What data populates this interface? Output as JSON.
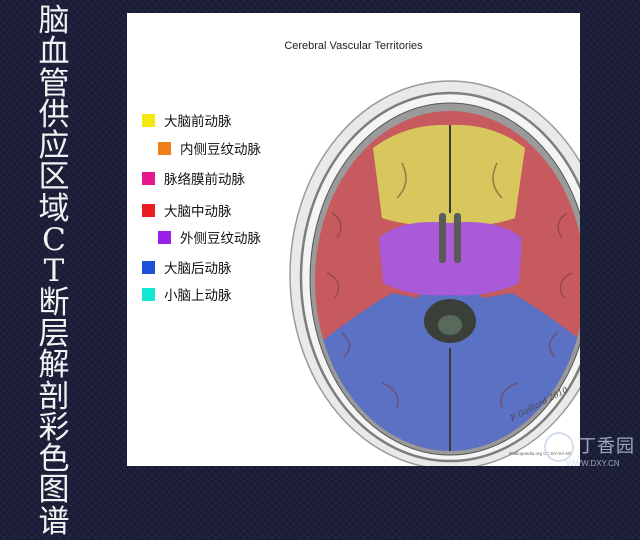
{
  "slide_title": "脑血管供应区域CT断层解剖彩色图谱",
  "figure": {
    "title": "Cerebral Vascular Territories",
    "signature": "F Gaillard 2010",
    "signature_url": "Radiopaedia.org CC BY-SA-NC"
  },
  "legend": [
    {
      "label": "大脑前动脉",
      "color": "#f4e80e"
    },
    {
      "label": "内侧豆纹动脉",
      "color": "#f07f1a"
    },
    {
      "label": "脉络膜前动脉",
      "color": "#e4178c"
    },
    {
      "label": "大脑中动脉",
      "color": "#ec1c24"
    },
    {
      "label": "外侧豆纹动脉",
      "color": "#9b1fe8"
    },
    {
      "label": "大脑后动脉",
      "color": "#1f4fd8"
    },
    {
      "label": "小脑上动脉",
      "color": "#14e6d4"
    }
  ],
  "watermark": {
    "name": "丁香园",
    "url": "WWW.DXY.CN"
  }
}
